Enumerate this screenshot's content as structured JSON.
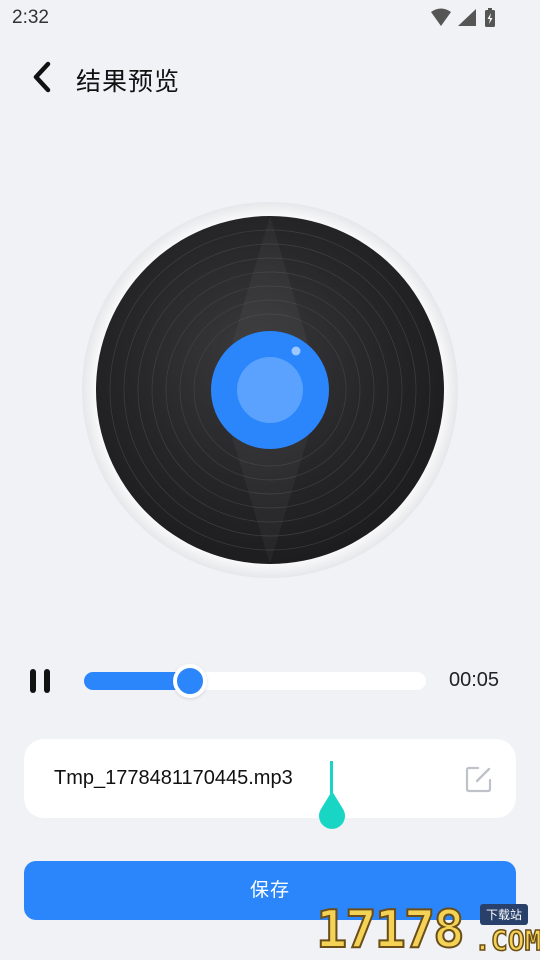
{
  "status_bar": {
    "time": "2:32"
  },
  "header": {
    "title": "结果预览"
  },
  "player": {
    "elapsed": "00:05",
    "progress": 0.31,
    "state": "playing"
  },
  "file": {
    "name": "Tmp_1778481170445.mp3"
  },
  "actions": {
    "save_label": "保存"
  },
  "watermark": {
    "digits": "17178",
    "tag": "下载站",
    "com": ".COM"
  },
  "colors": {
    "accent": "#2b86fb",
    "background": "#f1f2f6",
    "cursor": "#18d5c4",
    "disc": "#2a2a2c"
  }
}
